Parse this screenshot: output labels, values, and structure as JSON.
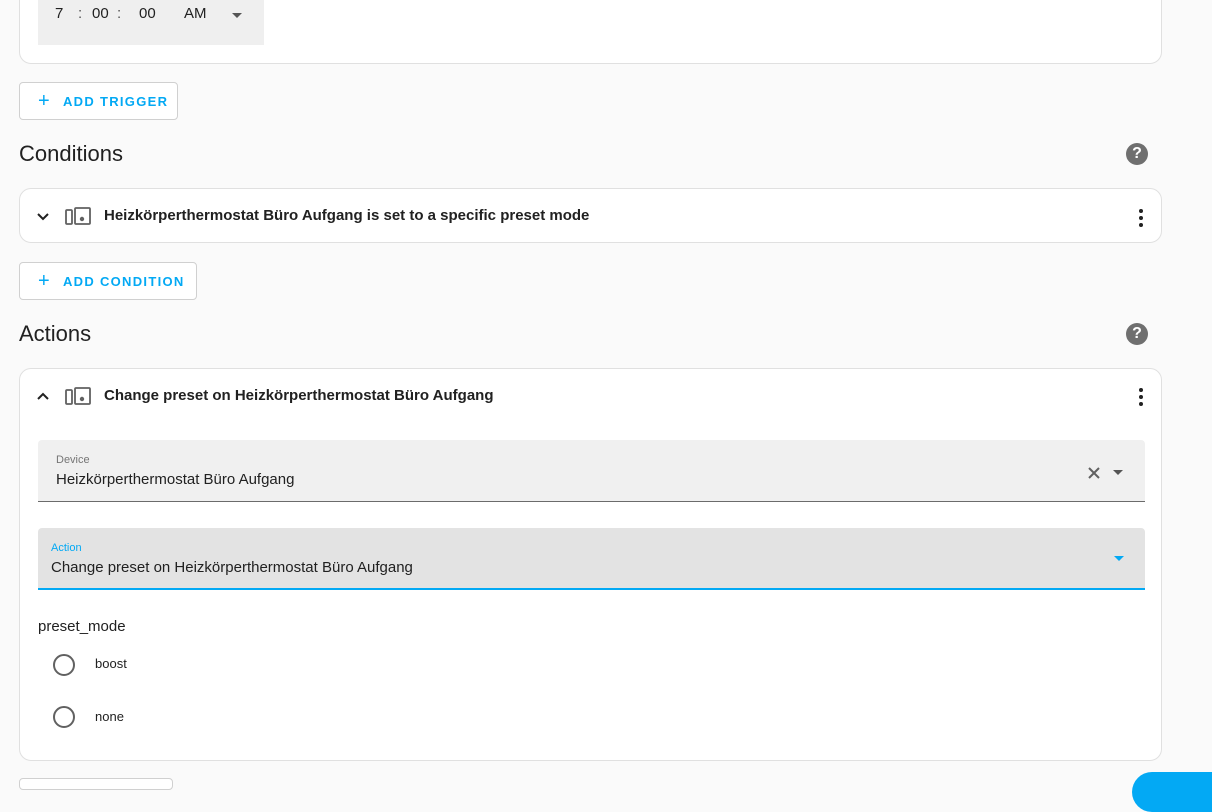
{
  "trigger_time": {
    "hours": "7",
    "minutes": "00",
    "seconds": "00",
    "separator": ":",
    "period": "AM"
  },
  "add_trigger_label": "ADD TRIGGER",
  "conditions": {
    "title": "Conditions",
    "item_title": "Heizkörperthermostat Büro Aufgang is set to a specific preset mode",
    "add_label": "ADD CONDITION"
  },
  "actions": {
    "title": "Actions",
    "item_title": "Change preset on Heizkörperthermostat Büro Aufgang",
    "device_label": "Device",
    "device_value": "Heizkörperthermostat Büro Aufgang",
    "action_label": "Action",
    "action_value": "Change preset on Heizkörperthermostat Büro Aufgang",
    "preset_label": "preset_mode",
    "options": [
      "boost",
      "none"
    ]
  },
  "icons": {
    "plus": "plus-icon",
    "help": "help-circle-icon",
    "expand": "chevron-down-icon",
    "collapse": "chevron-up-icon",
    "device": "devices-icon",
    "menu": "dots-vertical-icon",
    "clear": "close-icon",
    "dropdown": "menu-down-icon",
    "radio": "radio-unchecked-icon"
  },
  "colors": {
    "accent": "#03a9f4",
    "text": "#212121",
    "background": "#fafafa"
  }
}
